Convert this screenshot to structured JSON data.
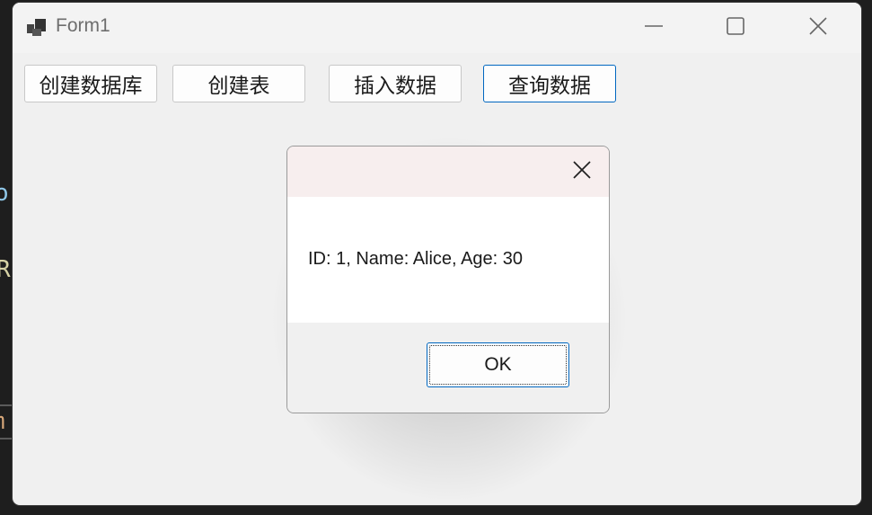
{
  "window": {
    "title": "Form1",
    "icons": [
      "app-icon",
      "minimize-icon",
      "maximize-icon",
      "close-icon"
    ]
  },
  "toolbar": {
    "create_database_label": "创建数据库",
    "create_table_label": "创建表",
    "insert_data_label": "插入数据",
    "query_data_label": "查询数据"
  },
  "dialog": {
    "message": "ID: 1, Name: Alice, Age: 30",
    "ok_label": "OK",
    "close_icon": "close-icon"
  },
  "background": {
    "fragments": [
      "o",
      "R",
      "m"
    ]
  },
  "colors": {
    "accent": "#0067c0",
    "window_bg": "#f0f0f0",
    "dialog_title_bg": "#f7eeee",
    "editor_bg": "#1e1e1e"
  }
}
